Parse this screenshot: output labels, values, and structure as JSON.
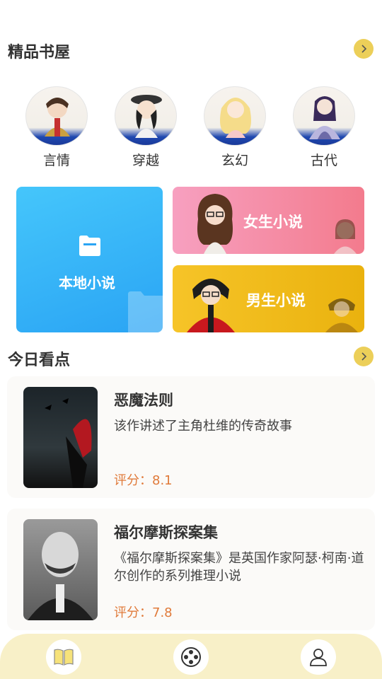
{
  "shelf": {
    "title": "精品书屋",
    "categories": [
      {
        "label": "言情"
      },
      {
        "label": "穿越"
      },
      {
        "label": "玄幻"
      },
      {
        "label": "古代"
      }
    ]
  },
  "banners": {
    "local": "本地小说",
    "female": "女生小说",
    "male": "男生小说"
  },
  "today": {
    "title": "今日看点",
    "books": [
      {
        "title": "恶魔法则",
        "desc": "该作讲述了主角杜维的传奇故事",
        "rating": "评分：8.1"
      },
      {
        "title": "福尔摩斯探案集",
        "desc": "《福尔摩斯探案集》是英国作家阿瑟·柯南·道尔创作的系列推理小说",
        "rating": "评分：7.8"
      }
    ]
  },
  "colors": {
    "accent": "#eccf59",
    "rating": "#e07a3a",
    "nav_bg": "#f8f0c8",
    "local_card": "#2aa4f4",
    "female_card": "#f37b8d",
    "male_card": "#eab20e"
  },
  "icons": {
    "more": "chevron-right-icon",
    "folder": "folder-icon",
    "nav": [
      "book-open-icon",
      "film-reel-icon",
      "user-icon"
    ]
  }
}
